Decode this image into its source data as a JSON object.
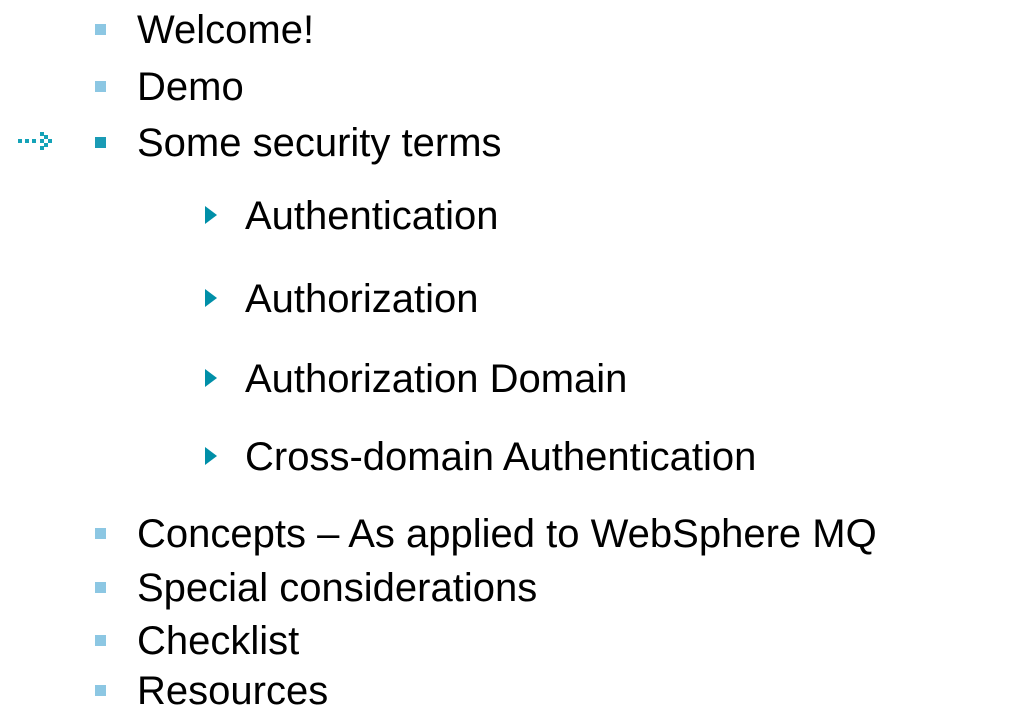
{
  "colors": {
    "bullet_normal": "#8cc7e3",
    "bullet_current": "#1a9bb5",
    "subbullet": "#008fa8",
    "marker": "#14a3b8"
  },
  "agenda": {
    "items": [
      {
        "label": "Welcome!",
        "current": false
      },
      {
        "label": "Demo",
        "current": false
      },
      {
        "label": "Some security terms",
        "current": true
      },
      {
        "label": "Concepts – As applied to WebSphere MQ",
        "current": false
      },
      {
        "label": "Special considerations",
        "current": false
      },
      {
        "label": "Checklist",
        "current": false
      },
      {
        "label": "Resources",
        "current": false
      }
    ],
    "subitems": [
      {
        "label": "Authentication"
      },
      {
        "label": "Authorization"
      },
      {
        "label": "Authorization Domain"
      },
      {
        "label": "Cross-domain Authentication"
      }
    ],
    "current_marker_icon": "dotted-arrow-icon"
  }
}
